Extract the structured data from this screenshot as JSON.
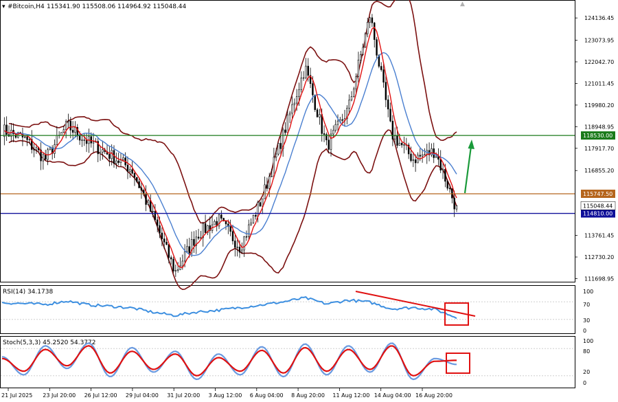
{
  "header": {
    "symbol": "#Bitcoin,H4",
    "ohlc": "115341.90 115508.06 114964.92 115048.44"
  },
  "colors": {
    "background": "#ffffff",
    "candle": "#000000",
    "bollinger": "#7b1010",
    "ma_fast": "#e01010",
    "ma_slow": "#4a7fd0",
    "level_green": "#1a7a1a",
    "level_orange": "#b5651d",
    "level_blue": "#10109a",
    "price_tag": "#10109a",
    "arrow": "#1a9a3a",
    "rsi": "#3d8fe0",
    "stoch_main": "#6a9ae0",
    "stoch_signal": "#e01010",
    "highlight": "#e01010",
    "trendline": "#e01010"
  },
  "price_axis": {
    "ticks": [
      "124136.45",
      "123073.95",
      "122042.70",
      "121011.45",
      "119980.20",
      "118948.95",
      "117917.70",
      "116855.20",
      "115747.50",
      "115048.44",
      "114810.00",
      "113761.45",
      "112730.20",
      "111698.95"
    ],
    "ylim": [
      111550,
      124600
    ]
  },
  "time_axis": {
    "labels": [
      "21 Jul 2025",
      "23 Jul 20:00",
      "26 Jul 12:00",
      "29 Jul 04:00",
      "31 Jul 20:00",
      "3 Aug 12:00",
      "6 Aug 04:00",
      "8 Aug 20:00",
      "11 Aug 12:00",
      "14 Aug 04:00",
      "16 Aug 20:00"
    ]
  },
  "levels": [
    {
      "name": "resistance",
      "value": 118530.0,
      "label": "118530.00",
      "color": "#1a7a1a"
    },
    {
      "name": "pivot",
      "value": 115747.5,
      "label": "115747.50",
      "color": "#b5651d"
    },
    {
      "name": "support",
      "value": 114810.0,
      "label": "114810.00",
      "color": "#10109a"
    }
  ],
  "current_price": {
    "value": 115048.44,
    "label": "115048.44"
  },
  "rsi": {
    "label": "RSI(14) 34.1738",
    "scale": [
      "100",
      "70",
      "30",
      "0"
    ]
  },
  "stoch": {
    "label": "Stoch(5,3,3) 45.2520 54.3772",
    "scale": [
      "100",
      "80",
      "20",
      "0"
    ]
  },
  "chart_data": {
    "type": "line",
    "title": "#Bitcoin,H4",
    "x": [
      "21 Jul 2025",
      "23 Jul 20:00",
      "26 Jul 12:00",
      "29 Jul 04:00",
      "31 Jul 20:00",
      "3 Aug 12:00",
      "6 Aug 04:00",
      "8 Aug 20:00",
      "11 Aug 12:00",
      "14 Aug 04:00",
      "16 Aug 20:00"
    ],
    "ylim": [
      111550,
      124600
    ],
    "series": [
      {
        "values": [
          118800,
          118400,
          117400,
          119000,
          118200,
          117600,
          116900,
          114600,
          112000,
          113800,
          114500,
          113200,
          115500,
          118600,
          121800,
          118000,
          119800,
          124300,
          118600,
          117400,
          117800,
          115000
        ]
      }
    ],
    "rsi_values": [
      68,
      66,
      64,
      72,
      63,
      60,
      56,
      46,
      39,
      47,
      51,
      57,
      63,
      70,
      79,
      65,
      74,
      69,
      54,
      57,
      53,
      34
    ],
    "stoch_main_values": [
      62,
      22,
      86,
      36,
      92,
      18,
      82,
      28,
      74,
      12,
      68,
      22,
      84,
      18,
      90,
      22,
      86,
      28,
      92,
      12,
      58,
      45
    ],
    "stoch_signal_values": [
      58,
      30,
      78,
      42,
      86,
      26,
      74,
      34,
      68,
      20,
      60,
      30,
      76,
      26,
      82,
      30,
      78,
      34,
      86,
      20,
      52,
      54
    ]
  }
}
